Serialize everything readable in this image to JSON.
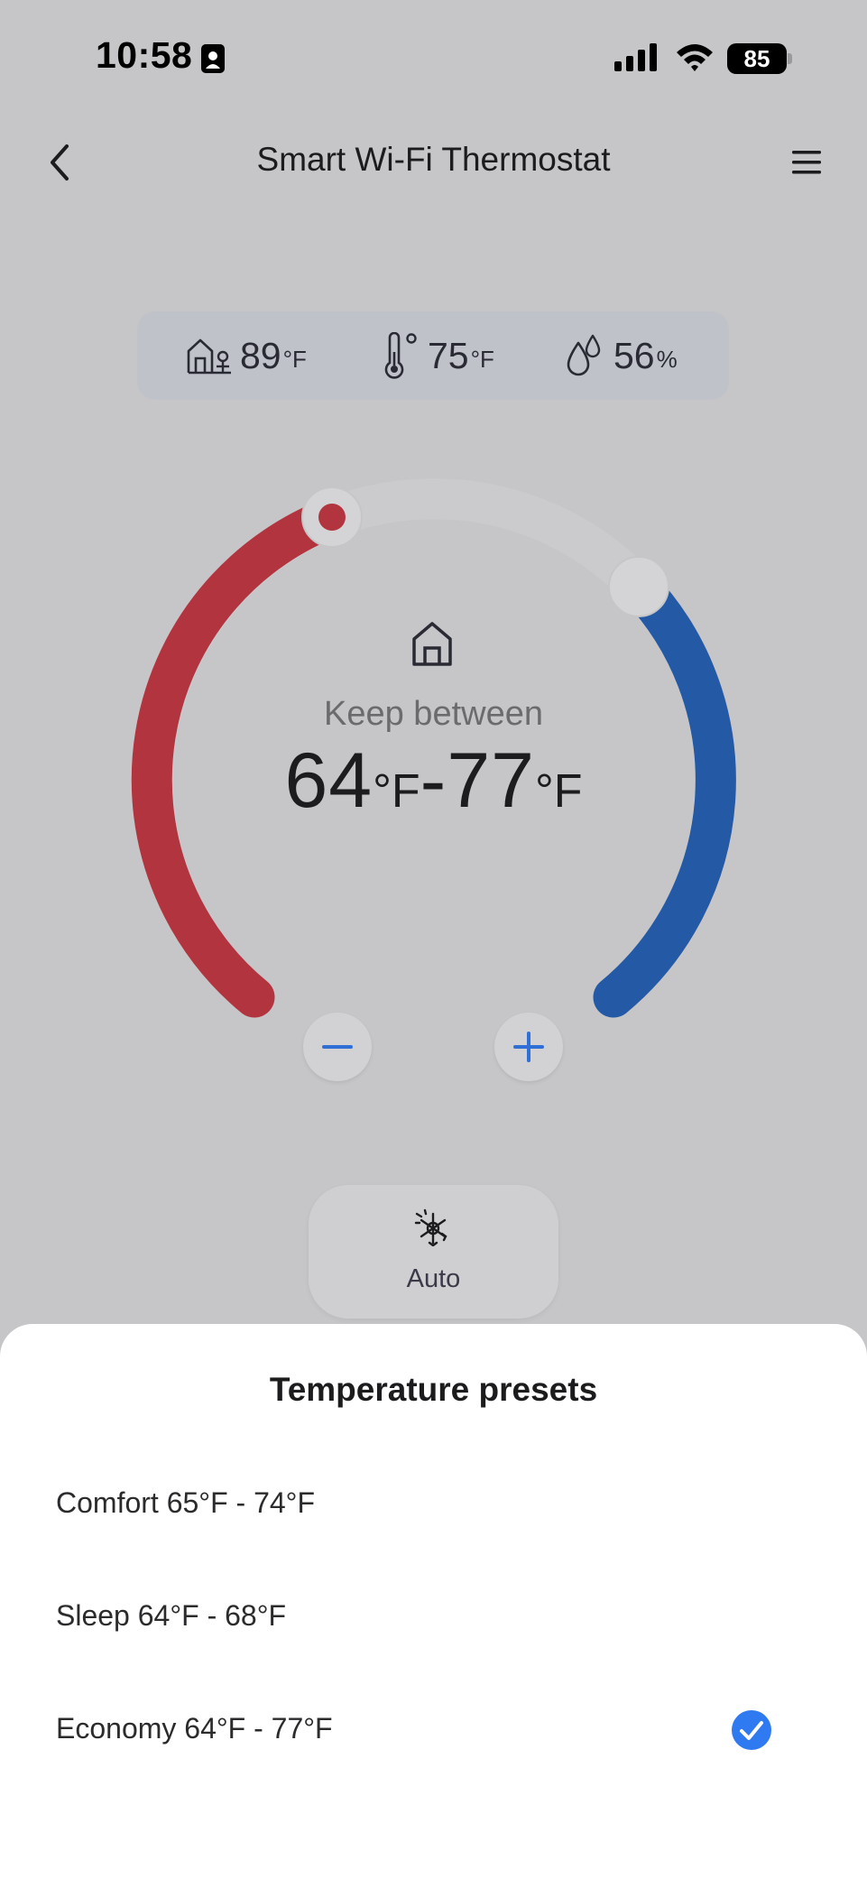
{
  "status_bar": {
    "time": "10:58",
    "battery": "85"
  },
  "header": {
    "title": "Smart Wi-Fi Thermostat"
  },
  "readings": {
    "outdoor": {
      "value": "89",
      "unit": "°F",
      "icon": "outdoor-home-icon"
    },
    "indoor": {
      "value": "75",
      "unit": "°F",
      "icon": "thermometer-icon"
    },
    "humidity": {
      "value": "56",
      "unit": "%",
      "icon": "humidity-drop-icon"
    }
  },
  "dial": {
    "mode_label": "Keep between",
    "low": "64",
    "high": "77",
    "unit": "°F",
    "dash": "-",
    "heat_color": "#b2343f",
    "cool_color": "#2459a5"
  },
  "mode": {
    "label": "Auto",
    "icon": "auto-heat-cool-icon"
  },
  "presets_sheet": {
    "title": "Temperature presets",
    "items": [
      {
        "label": "Comfort 65°F - 74°F",
        "selected": false
      },
      {
        "label": "Sleep 64°F - 68°F",
        "selected": false
      },
      {
        "label": "Economy 64°F - 77°F",
        "selected": true
      }
    ],
    "accent_color": "#2f7af1"
  }
}
